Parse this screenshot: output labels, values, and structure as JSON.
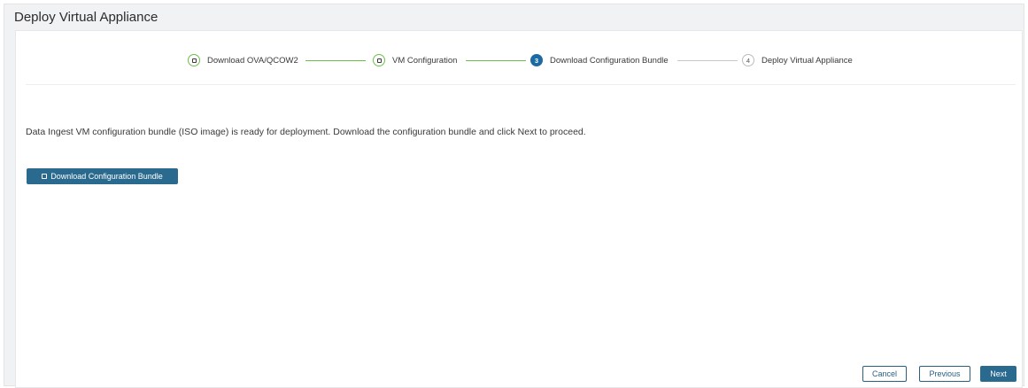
{
  "page": {
    "title": "Deploy Virtual Appliance"
  },
  "stepper": {
    "steps": [
      {
        "label": "Download OVA/QCOW2",
        "status": "completed",
        "marker": ""
      },
      {
        "label": "VM Configuration",
        "status": "completed",
        "marker": ""
      },
      {
        "label": "Download Configuration Bundle",
        "status": "active",
        "marker": "3"
      },
      {
        "label": "Deploy Virtual Appliance",
        "status": "pending",
        "marker": "4"
      }
    ]
  },
  "main": {
    "message": "Data Ingest VM configuration bundle (ISO image) is ready for deployment. Download the configuration bundle and click Next to proceed.",
    "download_button": "Download Configuration Bundle"
  },
  "footer": {
    "cancel": "Cancel",
    "previous": "Previous",
    "next": "Next"
  },
  "colors": {
    "primary": "#2a6a8f",
    "active_step": "#1c6aa3",
    "completed_step": "#6cc04a",
    "pending_step": "#b8bbbe"
  }
}
